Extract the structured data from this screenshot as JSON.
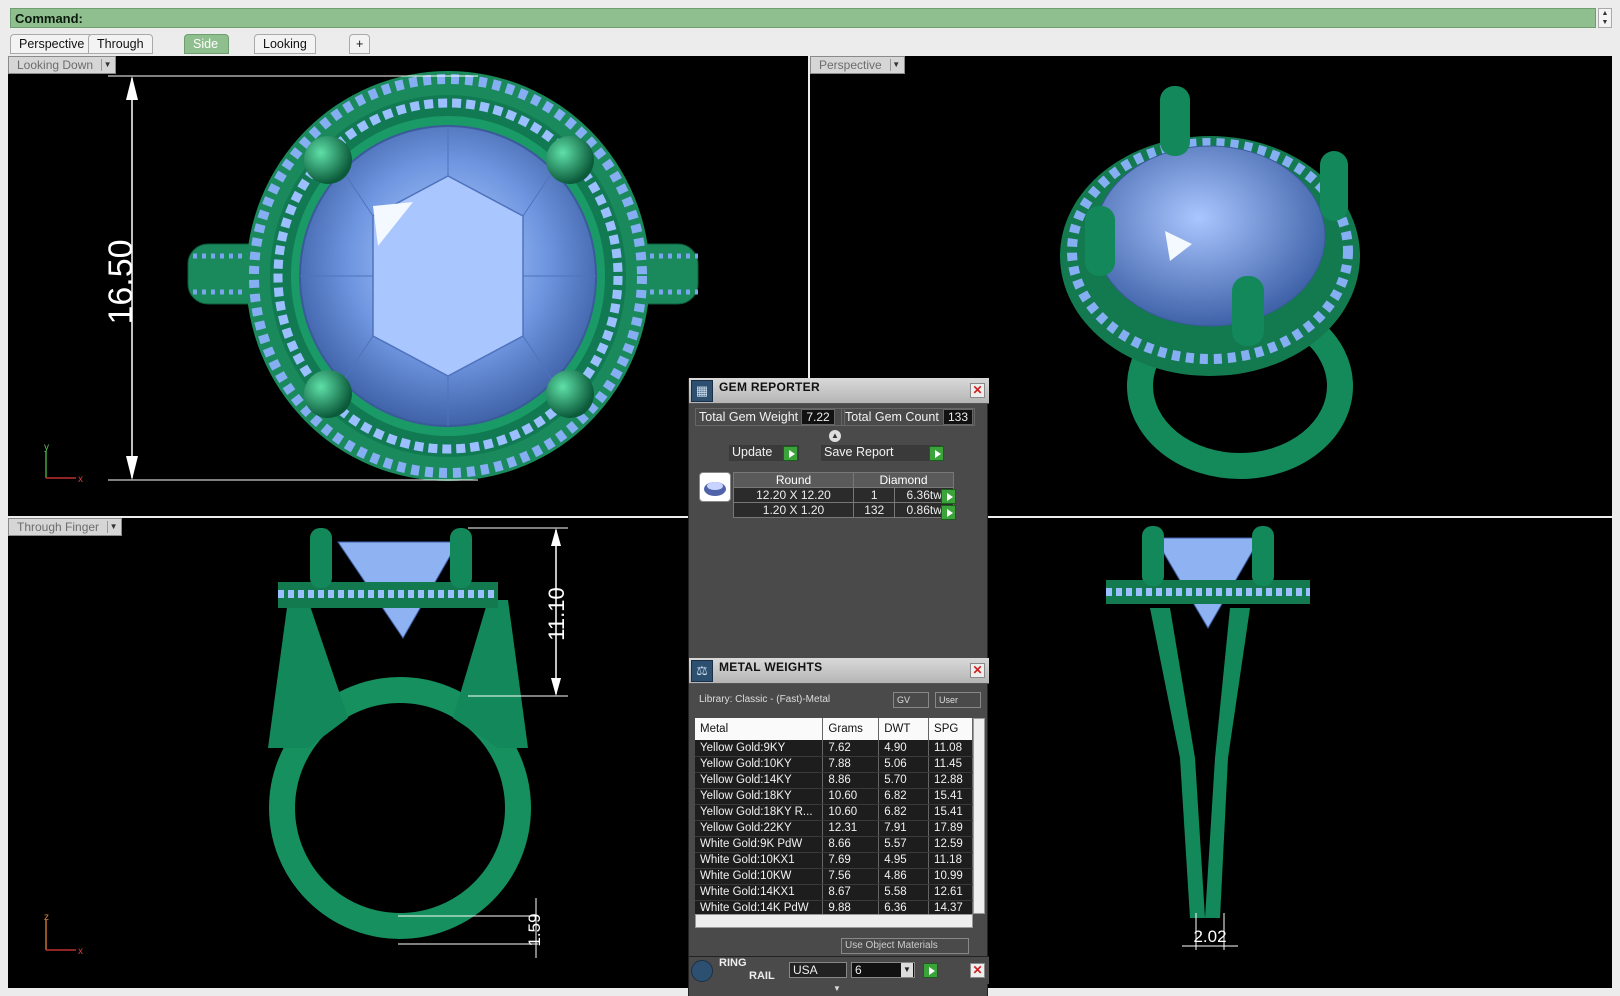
{
  "command": {
    "label": "Command:"
  },
  "tabs": [
    {
      "label": "Perspective",
      "active": false
    },
    {
      "label": "Through Finger",
      "active": false
    },
    {
      "label": "Side View",
      "active": true
    },
    {
      "label": "Looking Down",
      "active": false
    },
    {
      "label": "+",
      "active": false
    }
  ],
  "viewports": {
    "top_left": {
      "label": "Looking Down",
      "dimension": "16.50",
      "axis_v": "y",
      "axis_h": "x"
    },
    "top_right": {
      "label": "Perspective"
    },
    "bottom_left": {
      "label": "Through Finger",
      "dimension_top": "11.10",
      "dimension_bottom": "1.59",
      "axis_v": "z",
      "axis_h": "x"
    },
    "bottom_right": {
      "dimension": "2.02"
    }
  },
  "gem_reporter": {
    "title": "GEM REPORTER",
    "total_weight_label": "Total Gem Weight",
    "total_weight": "7.22",
    "total_count_label": "Total Gem Count",
    "total_count": "133",
    "update_label": "Update",
    "save_label": "Save Report",
    "table_header": [
      "Round",
      "Diamond"
    ],
    "rows": [
      {
        "size": "12.20 X 12.20",
        "count": "1",
        "weight": "6.36tw"
      },
      {
        "size": "1.20 X 1.20",
        "count": "132",
        "weight": "0.86tw"
      }
    ]
  },
  "metal_weights": {
    "title": "METAL WEIGHTS",
    "library": "Library: Classic - (Fast)-Metal",
    "gv_label": "GV",
    "user_label": "User",
    "columns": [
      "Metal",
      "Grams",
      "DWT",
      "SPG"
    ],
    "rows": [
      [
        "Yellow Gold:9KY",
        "7.62",
        "4.90",
        "11.08"
      ],
      [
        "Yellow Gold:10KY",
        "7.88",
        "5.06",
        "11.45"
      ],
      [
        "Yellow Gold:14KY",
        "8.86",
        "5.70",
        "12.88"
      ],
      [
        "Yellow Gold:18KY",
        "10.60",
        "6.82",
        "15.41"
      ],
      [
        "Yellow Gold:18KY R...",
        "10.60",
        "6.82",
        "15.41"
      ],
      [
        "Yellow Gold:22KY",
        "12.31",
        "7.91",
        "17.89"
      ],
      [
        "White Gold:9K PdW",
        "8.66",
        "5.57",
        "12.59"
      ],
      [
        "White Gold:10KX1",
        "7.69",
        "4.95",
        "11.18"
      ],
      [
        "White Gold:10KW",
        "7.56",
        "4.86",
        "10.99"
      ],
      [
        "White Gold:14KX1",
        "8.67",
        "5.58",
        "12.61"
      ],
      [
        "White Gold:14K PdW",
        "9.88",
        "6.36",
        "14.37"
      ]
    ],
    "use_object_materials": "Use Object Materials"
  },
  "ring_rail": {
    "title_1": "RING",
    "title_2": "RAIL",
    "country": "USA",
    "size": "6"
  }
}
